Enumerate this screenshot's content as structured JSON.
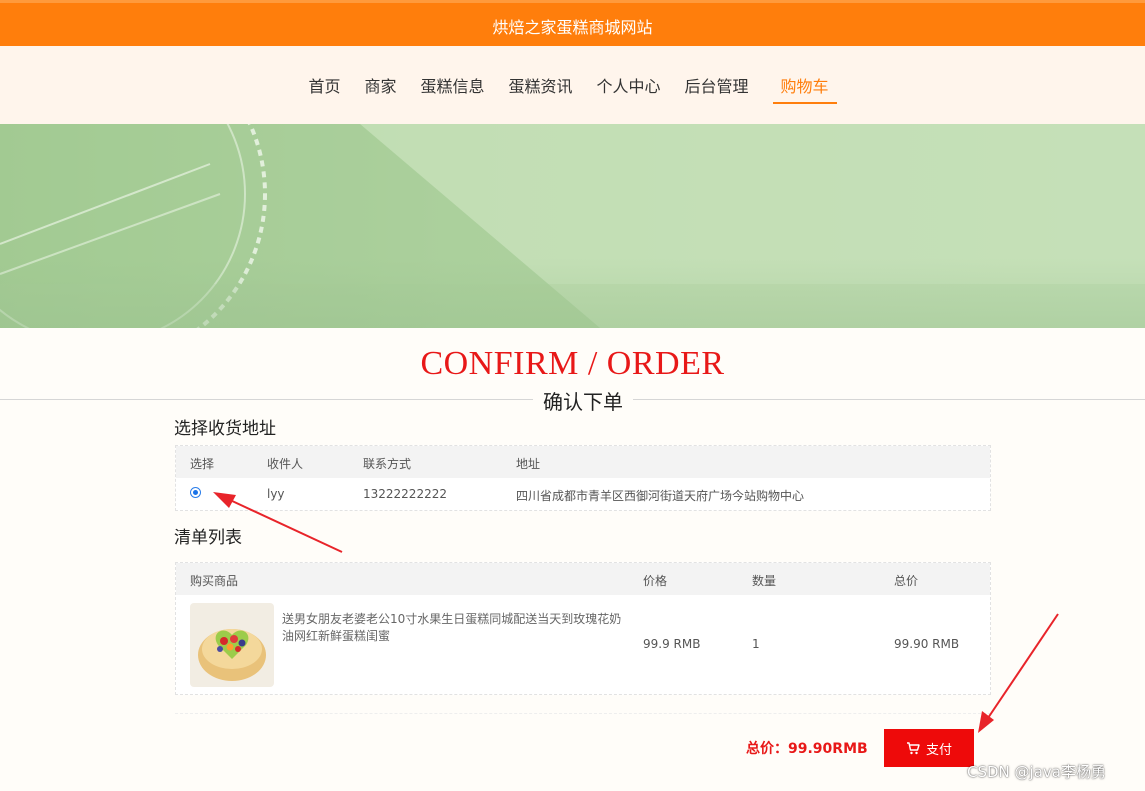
{
  "header": {
    "site_title": "烘焙之家蛋糕商城网站"
  },
  "nav": {
    "items": [
      "首页",
      "商家",
      "蛋糕信息",
      "蛋糕资讯",
      "个人中心",
      "后台管理",
      "购物车"
    ],
    "active": "购物车"
  },
  "page": {
    "title": "CONFIRM / ORDER",
    "subtitle": "确认下单"
  },
  "address_section": {
    "title": "选择收货地址",
    "columns": [
      "选择",
      "收件人",
      "联系方式",
      "地址"
    ],
    "rows": [
      {
        "selected": true,
        "recipient": "lyy",
        "phone": "13222222222",
        "address": "四川省成都市青羊区西御河街道天府广场今站购物中心"
      }
    ]
  },
  "order_section": {
    "title": "清单列表",
    "columns": [
      "购买商品",
      "价格",
      "数量",
      "总价"
    ],
    "items": [
      {
        "name": "送男女朋友老婆老公10寸水果生日蛋糕同城配送当天到玫瑰花奶油网红新鲜蛋糕闺蜜",
        "price": "99.9 RMB",
        "quantity": "1",
        "subtotal": "99.90 RMB",
        "image_icon": "cake-image"
      }
    ]
  },
  "summary": {
    "total_label": "总价：99.90RMB",
    "pay_label": "支付",
    "pay_icon": "cart-icon"
  },
  "watermark": "CSDN @java李杨勇",
  "colors": {
    "primary": "#ff7e0c",
    "accent_red": "#e81818",
    "pay_button": "#ee0a0a",
    "banner_green": "#b5d7a8"
  }
}
